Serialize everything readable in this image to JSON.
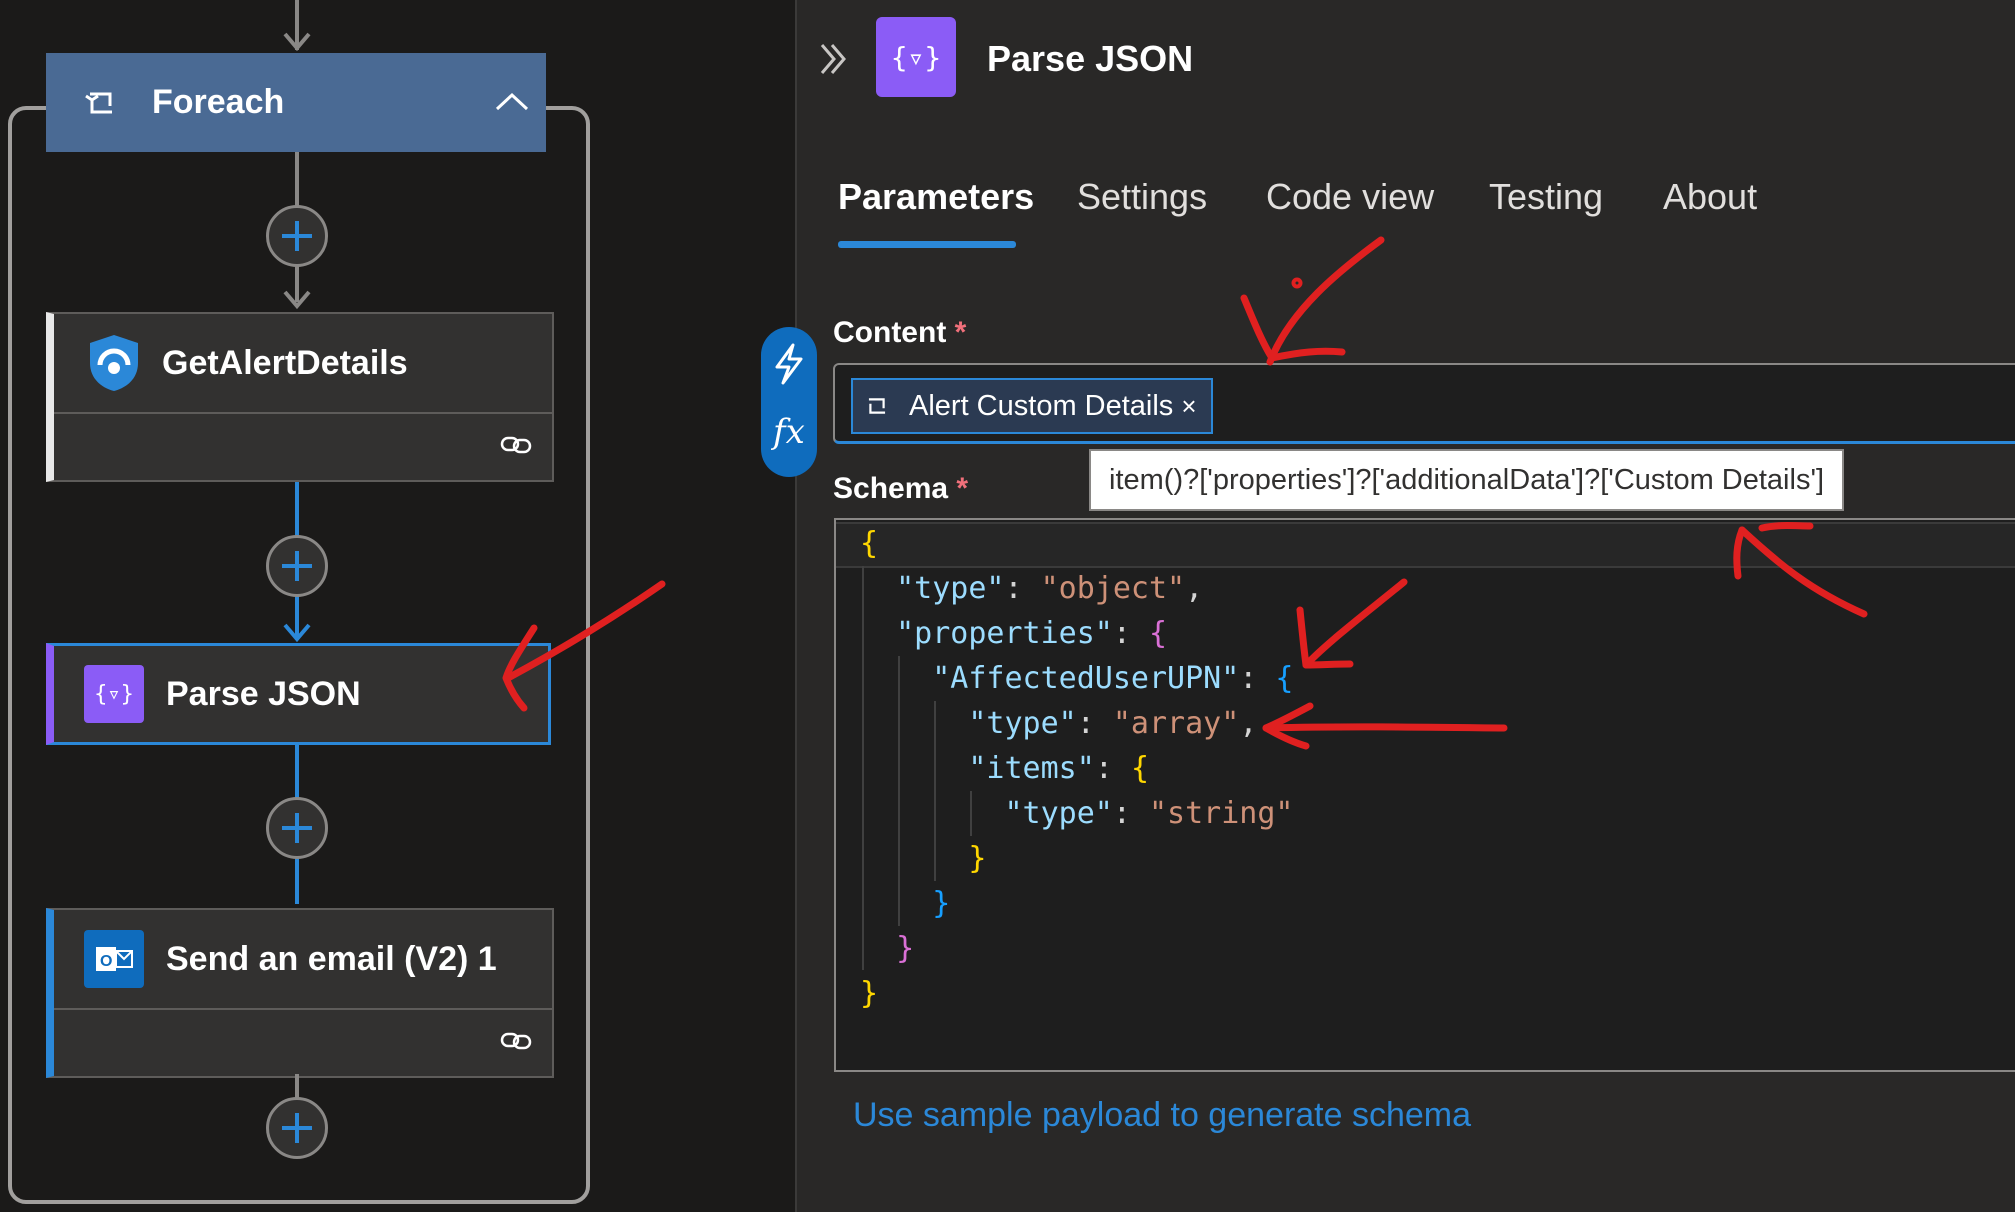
{
  "canvas": {
    "foreach": {
      "title": "Foreach"
    },
    "get_alert": {
      "title": "GetAlertDetails"
    },
    "parse_json": {
      "title": "Parse JSON"
    },
    "send_email": {
      "title": "Send an email (V2) 1"
    }
  },
  "panel": {
    "title": "Parse JSON",
    "tabs": [
      {
        "label": "Parameters"
      },
      {
        "label": "Settings"
      },
      {
        "label": "Code view"
      },
      {
        "label": "Testing"
      },
      {
        "label": "About"
      }
    ],
    "content": {
      "label": "Content",
      "required_mark": "*",
      "token": "Alert Custom Details",
      "token_remove": "×",
      "tooltip": "item()?['properties']?['additionalData']?['Custom Details']"
    },
    "schema": {
      "label": "Schema",
      "required_mark": "*",
      "k_type": "\"type\"",
      "v_object": "\"object\"",
      "k_properties": "\"properties\"",
      "k_affected": "\"AffectedUserUPN\"",
      "v_array": "\"array\"",
      "k_items": "\"items\"",
      "v_string": "\"string\""
    },
    "sample_link": "Use sample payload to generate schema"
  },
  "colors": {
    "accent": "#2b88d8",
    "foreach": "#4a6a94",
    "parse_icon": "#8b5cf6",
    "annotation": "#e02020"
  }
}
